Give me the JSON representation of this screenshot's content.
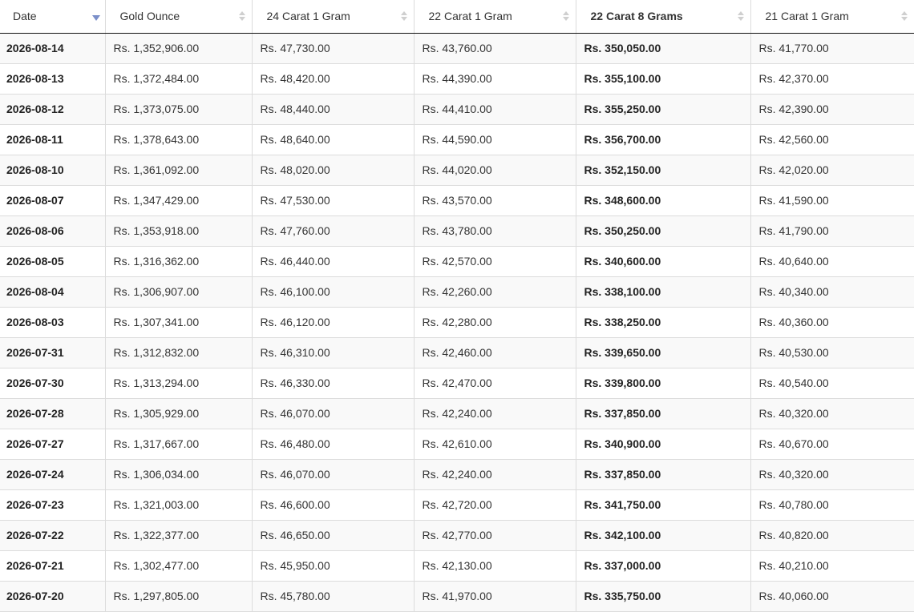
{
  "table": {
    "columns": [
      {
        "label": "Date",
        "bold": false,
        "sorted": true
      },
      {
        "label": "Gold Ounce",
        "bold": false,
        "sorted": false
      },
      {
        "label": "24 Carat 1 Gram",
        "bold": false,
        "sorted": false
      },
      {
        "label": "22 Carat 1 Gram",
        "bold": false,
        "sorted": false
      },
      {
        "label": "22 Carat 8 Grams",
        "bold": true,
        "sorted": false
      },
      {
        "label": "21 Carat 1 Gram",
        "bold": false,
        "sorted": false
      }
    ],
    "sort_active_color": "#7b8fc9",
    "rows": [
      [
        "2026-08-14",
        "Rs. 1,352,906.00",
        "Rs. 47,730.00",
        "Rs. 43,760.00",
        "Rs. 350,050.00",
        "Rs. 41,770.00"
      ],
      [
        "2026-08-13",
        "Rs. 1,372,484.00",
        "Rs. 48,420.00",
        "Rs. 44,390.00",
        "Rs. 355,100.00",
        "Rs. 42,370.00"
      ],
      [
        "2026-08-12",
        "Rs. 1,373,075.00",
        "Rs. 48,440.00",
        "Rs. 44,410.00",
        "Rs. 355,250.00",
        "Rs. 42,390.00"
      ],
      [
        "2026-08-11",
        "Rs. 1,378,643.00",
        "Rs. 48,640.00",
        "Rs. 44,590.00",
        "Rs. 356,700.00",
        "Rs. 42,560.00"
      ],
      [
        "2026-08-10",
        "Rs. 1,361,092.00",
        "Rs. 48,020.00",
        "Rs. 44,020.00",
        "Rs. 352,150.00",
        "Rs. 42,020.00"
      ],
      [
        "2026-08-07",
        "Rs. 1,347,429.00",
        "Rs. 47,530.00",
        "Rs. 43,570.00",
        "Rs. 348,600.00",
        "Rs. 41,590.00"
      ],
      [
        "2026-08-06",
        "Rs. 1,353,918.00",
        "Rs. 47,760.00",
        "Rs. 43,780.00",
        "Rs. 350,250.00",
        "Rs. 41,790.00"
      ],
      [
        "2026-08-05",
        "Rs. 1,316,362.00",
        "Rs. 46,440.00",
        "Rs. 42,570.00",
        "Rs. 340,600.00",
        "Rs. 40,640.00"
      ],
      [
        "2026-08-04",
        "Rs. 1,306,907.00",
        "Rs. 46,100.00",
        "Rs. 42,260.00",
        "Rs. 338,100.00",
        "Rs. 40,340.00"
      ],
      [
        "2026-08-03",
        "Rs. 1,307,341.00",
        "Rs. 46,120.00",
        "Rs. 42,280.00",
        "Rs. 338,250.00",
        "Rs. 40,360.00"
      ],
      [
        "2026-07-31",
        "Rs. 1,312,832.00",
        "Rs. 46,310.00",
        "Rs. 42,460.00",
        "Rs. 339,650.00",
        "Rs. 40,530.00"
      ],
      [
        "2026-07-30",
        "Rs. 1,313,294.00",
        "Rs. 46,330.00",
        "Rs. 42,470.00",
        "Rs. 339,800.00",
        "Rs. 40,540.00"
      ],
      [
        "2026-07-28",
        "Rs. 1,305,929.00",
        "Rs. 46,070.00",
        "Rs. 42,240.00",
        "Rs. 337,850.00",
        "Rs. 40,320.00"
      ],
      [
        "2026-07-27",
        "Rs. 1,317,667.00",
        "Rs. 46,480.00",
        "Rs. 42,610.00",
        "Rs. 340,900.00",
        "Rs. 40,670.00"
      ],
      [
        "2026-07-24",
        "Rs. 1,306,034.00",
        "Rs. 46,070.00",
        "Rs. 42,240.00",
        "Rs. 337,850.00",
        "Rs. 40,320.00"
      ],
      [
        "2026-07-23",
        "Rs. 1,321,003.00",
        "Rs. 46,600.00",
        "Rs. 42,720.00",
        "Rs. 341,750.00",
        "Rs. 40,780.00"
      ],
      [
        "2026-07-22",
        "Rs. 1,322,377.00",
        "Rs. 46,650.00",
        "Rs. 42,770.00",
        "Rs. 342,100.00",
        "Rs. 40,820.00"
      ],
      [
        "2026-07-21",
        "Rs. 1,302,477.00",
        "Rs. 45,950.00",
        "Rs. 42,130.00",
        "Rs. 337,000.00",
        "Rs. 40,210.00"
      ],
      [
        "2026-07-20",
        "Rs. 1,297,805.00",
        "Rs. 45,780.00",
        "Rs. 41,970.00",
        "Rs. 335,750.00",
        "Rs. 40,060.00"
      ]
    ]
  }
}
